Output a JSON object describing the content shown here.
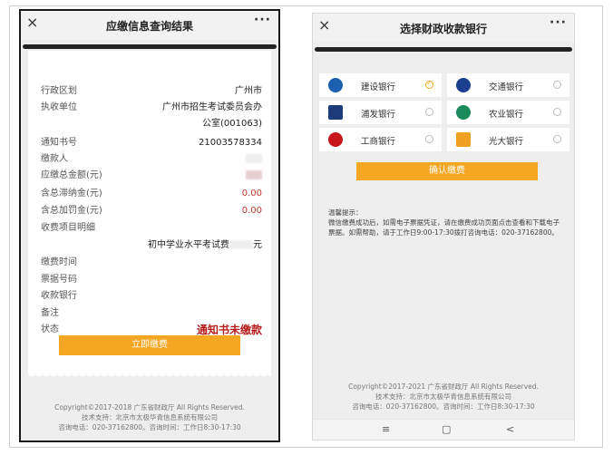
{
  "left": {
    "title": "应缴信息查询结果",
    "close": "×",
    "more": "···",
    "rows": [
      {
        "label": "行政区划",
        "value": "广州市"
      },
      {
        "label": "执收单位",
        "value": "广州市招生考试委员会办"
      },
      {
        "label": "",
        "value": "公室(001063)"
      },
      {
        "label": "通知书号",
        "value": "21003578334"
      },
      {
        "label": "缴款人",
        "value": ""
      },
      {
        "label": "应缴总金额(元)",
        "value": ""
      },
      {
        "label": "含总滞纳金(元)",
        "value": "0.00"
      },
      {
        "label": "含总加罚金(元)",
        "value": "0.00"
      },
      {
        "label": "收费项目明细",
        "value": ""
      },
      {
        "label": "",
        "value": "初中学业水平考试费"
      },
      {
        "label": "缴费时间",
        "value": ""
      },
      {
        "label": "票据号码",
        "value": ""
      },
      {
        "label": "收款银行",
        "value": ""
      },
      {
        "label": "备注",
        "value": ""
      },
      {
        "label": "状态",
        "value": "通知书未缴款"
      }
    ],
    "unit_suffix": "元",
    "pay_button": "立即缴费",
    "footer": [
      "Copyright©2017-2018 广东省财政厅 All Rights Reserved.",
      "技术支持：北京市太极华青信息系统有限公司",
      "咨询电话：020-37162800。咨询时间：工作日8:30-17:30"
    ]
  },
  "right": {
    "title": "选择财政收款银行",
    "close": "×",
    "more": "···",
    "banks": [
      {
        "name": "建设银行",
        "checked": true,
        "color": "#1c5fb0"
      },
      {
        "name": "交通银行",
        "checked": false,
        "color": "#1a3f8f"
      },
      {
        "name": "浦发银行",
        "checked": false,
        "color": "#1b3b7a"
      },
      {
        "name": "农业银行",
        "checked": false,
        "color": "#1a8a5a"
      },
      {
        "name": "工商银行",
        "checked": false,
        "color": "#c8161d"
      },
      {
        "name": "光大银行",
        "checked": false,
        "color": "#f0a020"
      }
    ],
    "confirm_button": "确认缴费",
    "tips_title": "温馨提示：",
    "tips_text": "微信缴费成功后，如需电子票据凭证，请在缴费成功页面点击查看和下载电子票据。如需帮助，请于工作日9:00-17:30拨打咨询电话：020-37162800。",
    "footer": [
      "Copyright©2017-2021 广东省财政厅 All Rights Reserved.",
      "技术支持：北京市太极华青信息系统有限公司",
      "咨询电话：020-37162800。咨询时间：工作日8:30-17:30"
    ],
    "nav": [
      "≡",
      "▢",
      "<"
    ]
  },
  "colors": {
    "accent": "#f5a623",
    "status_red": "#b71c1c",
    "amount_red": "#c0392b"
  }
}
